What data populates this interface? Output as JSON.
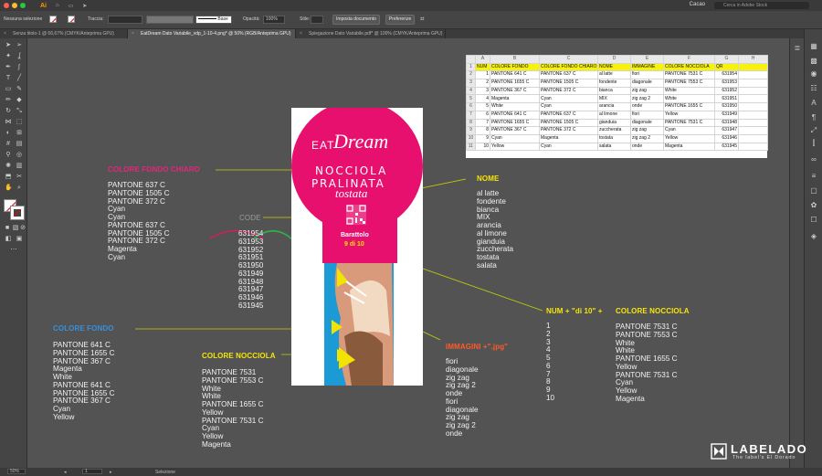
{
  "menubar": {
    "app_icon": "illustrator-logo",
    "workspace": "Cacao",
    "search_placeholder": "Cerca in Adobe Stock"
  },
  "controlbar": {
    "selection": "Nessuna selezione",
    "stroke_label": "Traccia:",
    "stroke_style": "Base",
    "opacity_label": "Opacità:",
    "opacity_value": "100%",
    "style_label": "Stile:",
    "doc_setup": "Imposta documento",
    "preferences": "Preferenze"
  },
  "tabs": [
    {
      "label": "Senza titolo-1 @ 66,67% (CMYK/Anteprima GPU)"
    },
    {
      "label": "EatDream Dato Variabile_vdp_1-10-4.png* @ 50% (RGB/Anteprima GPU)"
    },
    {
      "label": "Spiegazione Dato Variabile.pdf* @ 100% (CMYK/Anteprima GPU)"
    }
  ],
  "statusbar": {
    "zoom": "50%",
    "page": "1",
    "tool": "Selezione"
  },
  "annotations": {
    "colore_fondo_chiaro": {
      "label": "COLORE FONDO CHIARO",
      "color": "#e0287a",
      "values": [
        "PANTONE 637 C",
        "PANTONE 1505 C",
        "PANTONE 372 C",
        "Cyan",
        "Cyan",
        "PANTONE 637 C",
        "PANTONE 1505 C",
        "PANTONE 372 C",
        "Magenta",
        "Cyan"
      ]
    },
    "code": {
      "label": "CODE",
      "color": "#9a9a9a",
      "values": [
        "631954",
        "631953",
        "631952",
        "631951",
        "631950",
        "631949",
        "631948",
        "631947",
        "631946",
        "631945"
      ]
    },
    "nome": {
      "label": "NOME",
      "color": "#f5e50a",
      "values": [
        "al latte",
        "fondente",
        "bianca",
        "MIX",
        "arancia",
        "al limone",
        "gianduia",
        "zuccherata",
        "tostata",
        "salata"
      ]
    },
    "colore_fondo": {
      "label": "COLORE FONDO",
      "color": "#3a8fd6",
      "values": [
        "PANTONE 641  C",
        "PANTONE 1655 C",
        "PANTONE 367 C",
        "Magenta",
        "White",
        "PANTONE 641  C",
        "PANTONE 1655 C",
        "PANTONE 367 C",
        "Cyan",
        "Yellow"
      ]
    },
    "colore_nocciola": {
      "label": "COLORE NOCCIOLA",
      "color": "#f5e50a",
      "values": [
        "PANTONE 7531",
        "PANTONE 7553 C",
        "White",
        "White",
        "PANTONE 1655 C",
        "Yellow",
        "PANTONE 7531 C",
        "Cyan",
        "Yellow",
        "Magenta"
      ]
    },
    "immagini": {
      "label": "IMMAGINI +\".jpg\"",
      "color": "#ff5a2a",
      "values": [
        "fiori",
        "diagonale",
        "zig zag",
        "zig zag 2",
        "onde",
        "fiori",
        "diagonale",
        "zig zag",
        "zig zag 2",
        "onde"
      ]
    },
    "num_di10": {
      "label": "NUM + \"di 10\"  +",
      "color": "#f5e50a",
      "values": [
        "1",
        "2",
        "3",
        "4",
        "5",
        "6",
        "7",
        "8",
        "9",
        "10"
      ]
    },
    "colore_nocciola_2": {
      "label": "COLORE NOCCIOLA",
      "color": "#f5e50a",
      "values": [
        "PANTONE 7531 C",
        "PANTONE 7553 C",
        "White",
        "White",
        "PANTONE 1655 C",
        "Yellow",
        "PANTONE 7531 C",
        "Cyan",
        "Yellow",
        "Magenta"
      ]
    }
  },
  "spreadsheet": {
    "col_letters": [
      "",
      "A",
      "B",
      "C",
      "D",
      "E",
      "F",
      "G",
      "H"
    ],
    "header": [
      "NUM",
      "COLORE FONDO",
      "COLORE FONDO CHIARO",
      "NOME",
      "IMMAGINE",
      "COLORE NOCCIOLA",
      "QR",
      ""
    ],
    "rows": [
      [
        "1",
        "PANTONE 641 C",
        "PANTONE 637 C",
        "al latte",
        "fiori",
        "PANTONE 7531 C",
        "631954"
      ],
      [
        "2",
        "PANTONE 1655 C",
        "PANTONE 1505 C",
        "fondente",
        "diagonale",
        "PANTONE 7553 C",
        "631953"
      ],
      [
        "3",
        "PANTONE 367 C",
        "PANTONE 372 C",
        "bianca",
        "zig zag",
        "White",
        "631952"
      ],
      [
        "4",
        "Magenta",
        "Cyan",
        "MIX",
        "zig zag 2",
        "White",
        "631951"
      ],
      [
        "5",
        "White",
        "Cyan",
        "arancia",
        "onde",
        "PANTONE 1655 C",
        "631950"
      ],
      [
        "6",
        "PANTONE 641 C",
        "PANTONE 637 C",
        "al limone",
        "fiori",
        "Yellow",
        "631949"
      ],
      [
        "7",
        "PANTONE 1655 C",
        "PANTONE 1505 C",
        "gianduia",
        "diagonale",
        "PANTONE 7531 C",
        "631948"
      ],
      [
        "8",
        "PANTONE 367 C",
        "PANTONE 372 C",
        "zuccherata",
        "zig zag",
        "Cyan",
        "631947"
      ],
      [
        "9",
        "Cyan",
        "Magenta",
        "tostata",
        "zig zag 2",
        "Yellow",
        "631946"
      ],
      [
        "10",
        "Yellow",
        "Cyan",
        "salata",
        "onde",
        "Magenta",
        "631945"
      ]
    ]
  },
  "artwork": {
    "brand_eat": "EAT",
    "brand_dream": "Dream",
    "line1": "NOCCIOLA",
    "line2": "PRALINATA",
    "line3": "tostata",
    "jar_label": "Barattolo",
    "jar_count": "9 di 10",
    "colors": {
      "background": "#e8106e",
      "cyan": "#1b9ad6",
      "hazelnut": "#f2e400",
      "wrapper": "#d99a7c"
    }
  },
  "logo": {
    "name": "LABELADO",
    "tagline": "The label's El Dorado",
    "icon": "labelado-logo-icon"
  }
}
